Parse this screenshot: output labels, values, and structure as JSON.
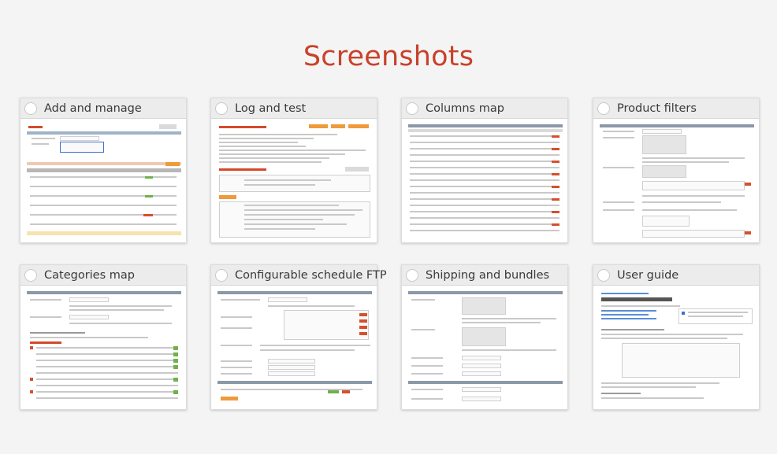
{
  "page": {
    "title": "Screenshots"
  },
  "cards": [
    {
      "title": "Add and manage"
    },
    {
      "title": "Log and test"
    },
    {
      "title": "Columns map"
    },
    {
      "title": "Product filters"
    },
    {
      "title": "Categories map"
    },
    {
      "title": "Configurable schedule FTP"
    },
    {
      "title": "Shipping and bundles"
    },
    {
      "title": "User guide"
    }
  ],
  "colors": {
    "title": "#c9412a",
    "card_header": "#ececec",
    "accent_orange": "#ef9a3c"
  }
}
